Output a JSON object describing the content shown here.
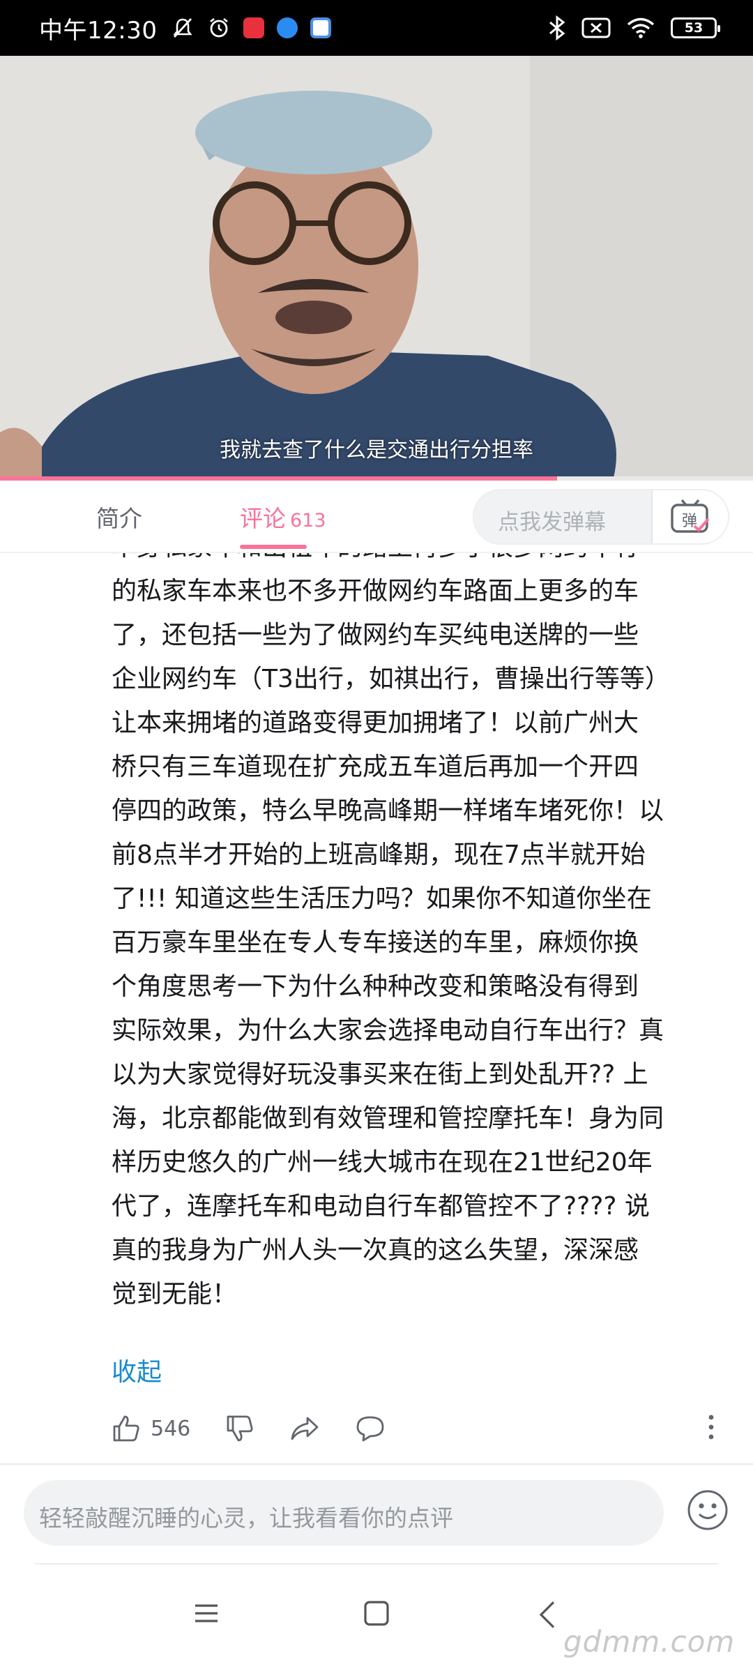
{
  "status_bar": {
    "time": "中午12:30",
    "battery": "53",
    "icons": [
      "mute-icon",
      "alarm-icon",
      "app-icon",
      "app-icon",
      "app-icon",
      "bluetooth-icon",
      "sim-disabled-icon",
      "wifi-icon",
      "battery-icon"
    ]
  },
  "video": {
    "subtitle": "我就去查了什么是交通出行分担率",
    "progress_fraction": 0.74
  },
  "tabs": {
    "intro": "简介",
    "comments": "评论",
    "comment_count": "613",
    "danmaku_placeholder": "点我发弹幕",
    "danmaku_toggle_icon": "danmaku-toggle-icon",
    "danmaku_toggle_label": "弹"
  },
  "comment": {
    "lines": [
      "本身私家车和出租车的路上再多了很多网约车有",
      "的私家车本来也不多开做网约车路面上更多的车",
      "了，还包括一些为了做网约车买纯电送牌的一些",
      "企业网约车（T3出行，如祺出行，曹操出行等等）",
      "让本来拥堵的道路变得更加拥堵了！以前广州大",
      "桥只有三车道现在扩充成五车道后再加一个开四",
      "停四的政策，特么早晚高峰期一样堵车堵死你！以",
      "前8点半才开始的上班高峰期，现在7点半就开始",
      "了!!! 知道这些生活压力吗？如果你不知道你坐在",
      "百万豪车里坐在专人专车接送的车里，麻烦你换",
      "个角度思考一下为什么种种改变和策略没有得到",
      "实际效果，为什么大家会选择电动自行车出行？真",
      "以为大家觉得好玩没事买来在街上到处乱开?? 上",
      "海，北京都能做到有效管理和管控摩托车！身为同",
      "样历史悠久的广州一线大城市在现在21世纪20年",
      "代了，连摩托车和电动自行车都管控不了???? 说",
      "真的我身为广州人头一次真的这么失望，深深感",
      "觉到无能！"
    ],
    "collapse": "收起",
    "like_count": "546"
  },
  "reply": {
    "placeholder": "轻轻敲醒沉睡的心灵，让我看看你的点评"
  },
  "watermark": "gdmm.com",
  "colors": {
    "accent": "#fb7299",
    "link": "#178bcf",
    "text": "#18191c",
    "secondary": "#61666d"
  }
}
